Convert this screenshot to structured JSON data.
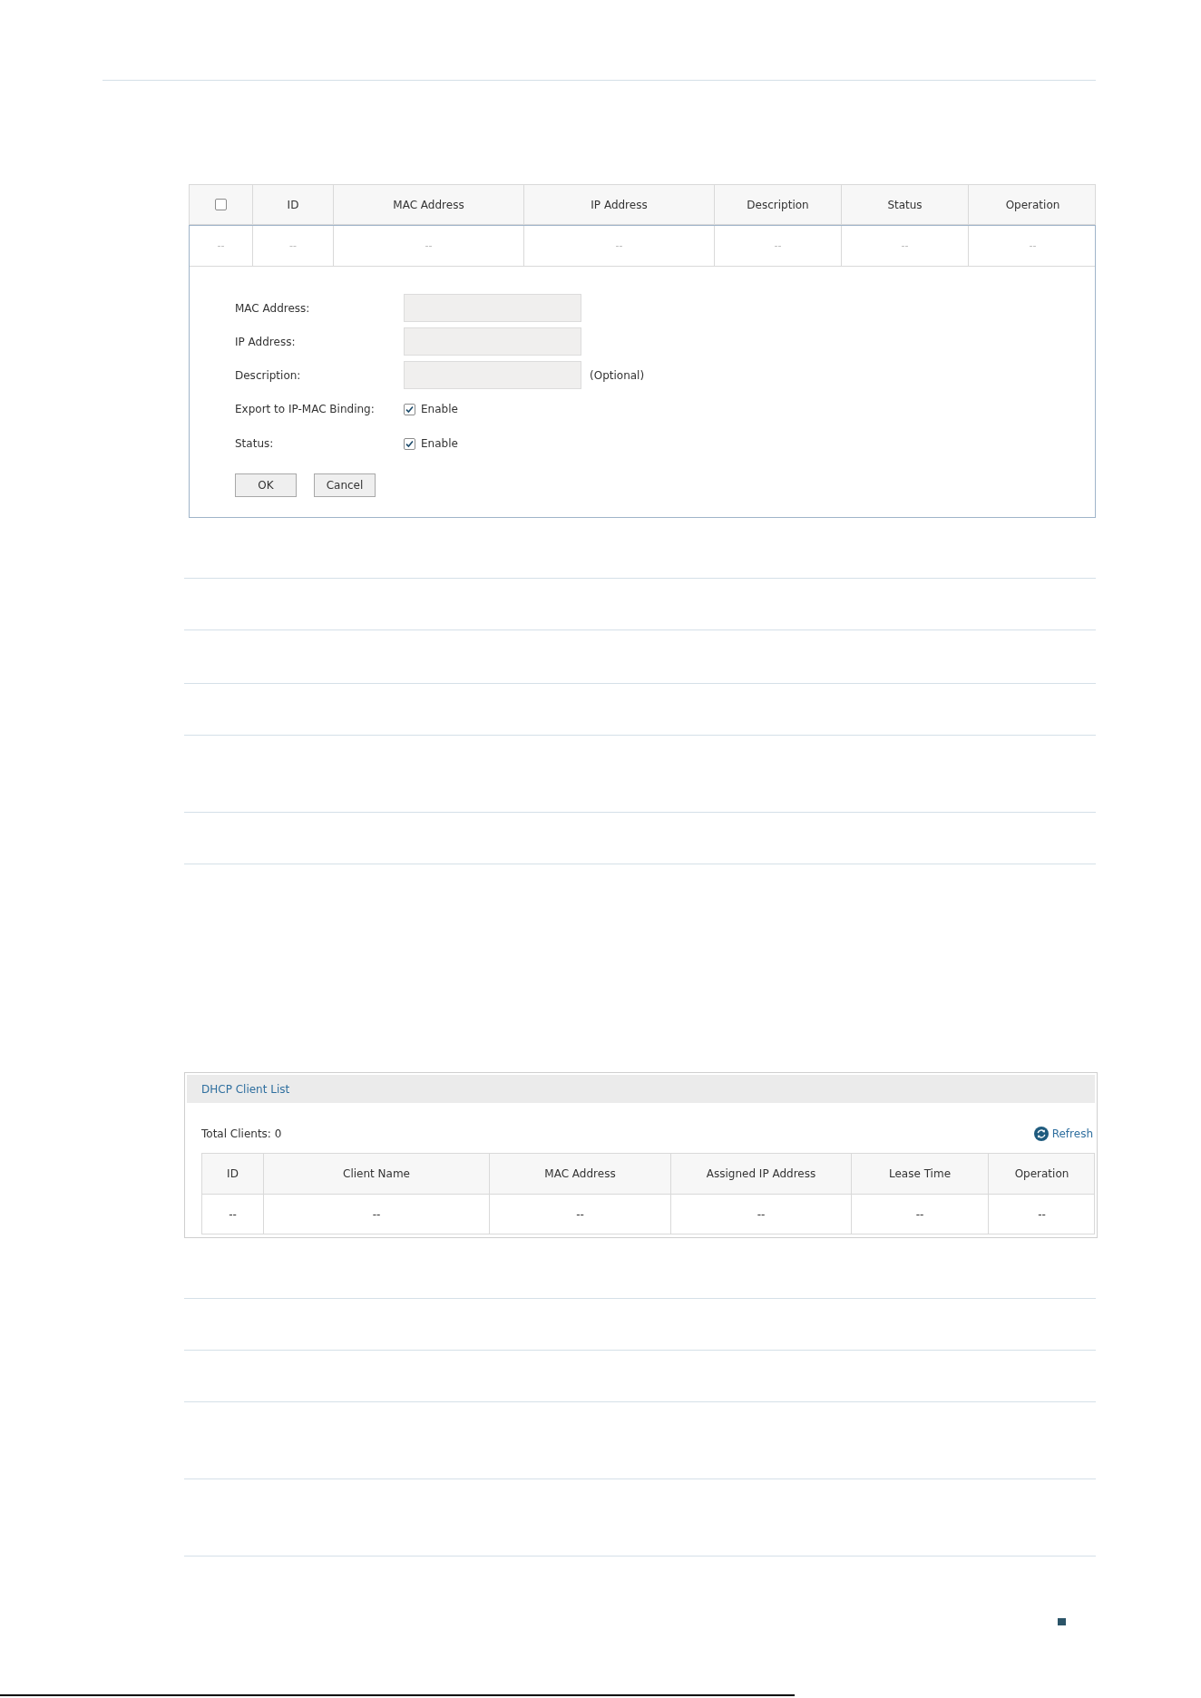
{
  "binding_table": {
    "columns": [
      {
        "kind": "select_all",
        "checked": false
      },
      {
        "kind": "text",
        "label": "ID"
      },
      {
        "kind": "text",
        "label": "MAC Address"
      },
      {
        "kind": "text",
        "label": "IP Address"
      },
      {
        "kind": "text",
        "label": "Description"
      },
      {
        "kind": "text",
        "label": "Status"
      },
      {
        "kind": "text",
        "label": "Operation"
      }
    ],
    "rows": [
      {
        "cells": [
          "--",
          "--",
          "--",
          "--",
          "--",
          "--",
          "--"
        ]
      }
    ]
  },
  "binding_form": {
    "fields": [
      {
        "kind": "text",
        "label": "MAC Address:"
      },
      {
        "kind": "text",
        "label": "IP Address:"
      },
      {
        "kind": "text",
        "label": "Description:",
        "note": "(Optional)"
      },
      {
        "kind": "checkbox",
        "label": "Export to IP-MAC Binding:",
        "option": "Enable",
        "checked": true
      },
      {
        "kind": "checkbox",
        "label": "Status:",
        "option": "Enable",
        "checked": true
      }
    ],
    "buttons": [
      "OK",
      "Cancel"
    ]
  },
  "dhcp_client_list": {
    "title": "DHCP Client List",
    "total": "Total Clients: 0",
    "refresh": "Refresh",
    "columns": [
      "ID",
      "Client Name",
      "MAC Address",
      "Assigned IP Address",
      "Lease Time",
      "Operation"
    ],
    "rows": [
      {
        "cells": [
          "--",
          "--",
          "--",
          "--",
          "--",
          "--"
        ]
      }
    ]
  }
}
